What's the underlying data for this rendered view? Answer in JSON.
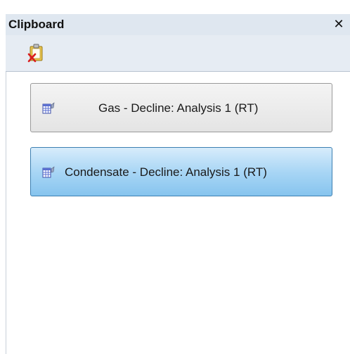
{
  "panel": {
    "title": "Clipboard",
    "close_glyph": "✕",
    "close_icon": "close-icon"
  },
  "toolbar": {
    "clear_icon": "clear-clipboard-icon"
  },
  "items": [
    {
      "label": "Gas - Decline: Analysis 1 (RT)",
      "icon": "table-data-icon",
      "selected": false
    },
    {
      "label": "Condensate - Decline: Analysis 1 (RT)",
      "icon": "table-data-icon",
      "selected": true
    }
  ],
  "colors": {
    "title_bg": "#dfe7f0",
    "selected_bg": "#a9d6f5",
    "selected_border": "#3c7fb1",
    "item_border": "#9a9a9a"
  }
}
